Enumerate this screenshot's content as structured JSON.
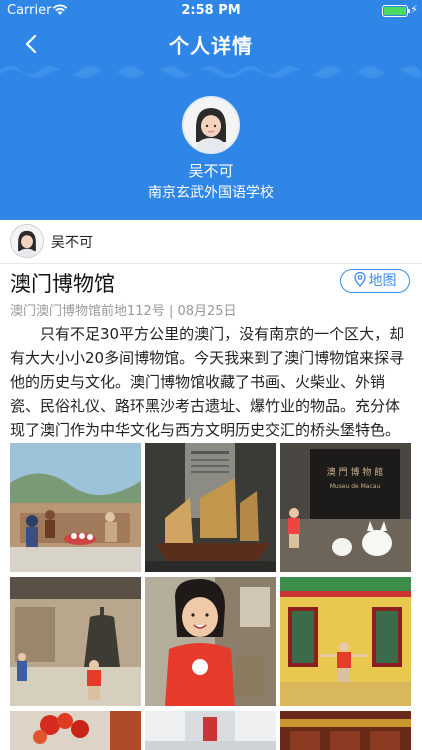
{
  "status_bar": {
    "carrier": "Carrier",
    "time": "2:58 PM"
  },
  "nav": {
    "title": "个人详情"
  },
  "profile": {
    "name": "吴不可",
    "school": "南京玄武外国语学校"
  },
  "author": {
    "name": "吴不可"
  },
  "post": {
    "title": "澳门博物馆",
    "map_label": "地图",
    "meta": "澳门澳门博物馆前地112号 | 08月25日",
    "body": "只有不足30平方公里的澳门，没有南京的一个区大，却有大大小小20多间博物馆。今天我来到了澳门博物馆来探寻他的历史与文化。澳门博物馆收藏了书画、火柴业、外销瓷、民俗礼仪、路环黑沙考古遗址、爆竹业的物品。充分体现了澳门作为中华文化与西方文明历史交汇的桥头堡特色。"
  },
  "photos": [
    {
      "name": "diorama-photo"
    },
    {
      "name": "junk-ship-model-photo"
    },
    {
      "name": "museum-sign-photo",
      "sign_text": "澳 門 博 物 館",
      "sign_sub": "Museu de Macau"
    },
    {
      "name": "bell-exhibit-photo"
    },
    {
      "name": "girl-closeup-photo"
    },
    {
      "name": "yellow-building-photo"
    },
    {
      "name": "red-flowers-photo"
    },
    {
      "name": "white-hall-photo"
    },
    {
      "name": "red-decor-photo"
    }
  ],
  "colors": {
    "header_blue": "#2f86e6",
    "accent_blue": "#3b8ce8",
    "meta_gray": "#999999"
  }
}
